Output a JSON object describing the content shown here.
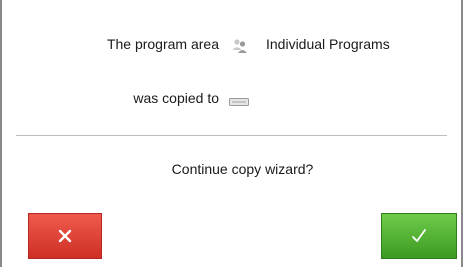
{
  "dialog": {
    "area_label": "The program area",
    "area_value": "Individual Programs",
    "area_icon": "program-group-icon",
    "copied_label": "was copied to",
    "destination_icon": "storage-drive-icon",
    "question": "Continue copy wizard?"
  },
  "buttons": {
    "cancel_icon": "close-icon",
    "confirm_icon": "checkmark-icon"
  },
  "colors": {
    "cancel": "#e0463b",
    "confirm": "#52b236",
    "text": "#1a1a1a",
    "divider": "#bdbdbd"
  }
}
